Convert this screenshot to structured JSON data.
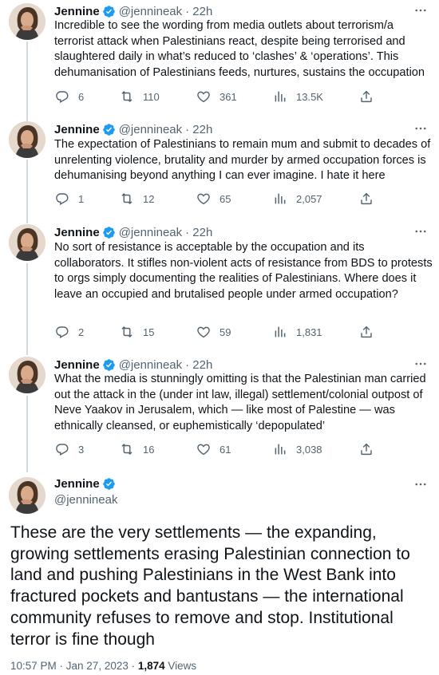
{
  "colors": {
    "verified": "#1d9bf0",
    "text": "#0f1419",
    "secondary": "#536471",
    "thread_line": "#cfd9de"
  },
  "icons": {
    "reply": "reply-icon",
    "retweet": "retweet-icon",
    "like": "heart-icon",
    "views": "views-icon",
    "share": "share-icon",
    "more": "more-icon",
    "verified": "verified-badge-icon"
  },
  "tweets": [
    {
      "name": "Jennine",
      "handle": "@jennineak",
      "time": "· 22h",
      "text": "Incredible to see the wording from media outlets about terrorism/a terrorist attack when Palestinians react, despite being terrorised and slaughtered daily in what’s reduced to ‘clashes’ & ‘operations’. This dehumanisation of Palestinians feeds, nurtures, sustains the occupation",
      "replies": "6",
      "retweets": "110",
      "likes": "361",
      "views": "13.5K"
    },
    {
      "name": "Jennine",
      "handle": "@jennineak",
      "time": "· 22h",
      "text": "The expectation of Palestinians to remain mum and submit to decades of unrelenting violence, brutality and murder by armed occupation forces is dehumanising beyond anything I can ever imagine. I hate it here",
      "replies": "1",
      "retweets": "12",
      "likes": "65",
      "views": "2,057"
    },
    {
      "name": "Jennine",
      "handle": "@jennineak",
      "time": "· 22h",
      "text": "No sort of resistance is acceptable by the occupation and its collaborators. It stifles non-violent acts of resistance from BDS to protests to orgs simply documenting the realities of Palestinians. Where does it leave an occupied and brutalised people under armed occupation?",
      "replies": "2",
      "retweets": "15",
      "likes": "59",
      "views": "1,831"
    },
    {
      "name": "Jennine",
      "handle": "@jennineak",
      "time": "· 22h",
      "text": "What the media is stunningly omitting is that the Palestinian man carried out the attack in the (under int law, illegal) settlement/colonial outpost of Neve Yaakov in Jerusalem, which — like most of Palestine — was ethnically cleansed, or euphemistically ‘depopulated’",
      "replies": "3",
      "retweets": "16",
      "likes": "61",
      "views": "3,038"
    }
  ],
  "main": {
    "name": "Jennine",
    "handle": "@jennineak",
    "text": "These are the very settlements — the expanding, growing settlements erasing Palestinian connection to land and pushing Palestinians in the West Bank into fractured pockets and bantustans — the international community refuses to remove and stop. Institutional terror is fine though",
    "time": "10:57 PM · Jan 27, 2023 · ",
    "views_count": "1,874",
    "views_label": " Views"
  }
}
